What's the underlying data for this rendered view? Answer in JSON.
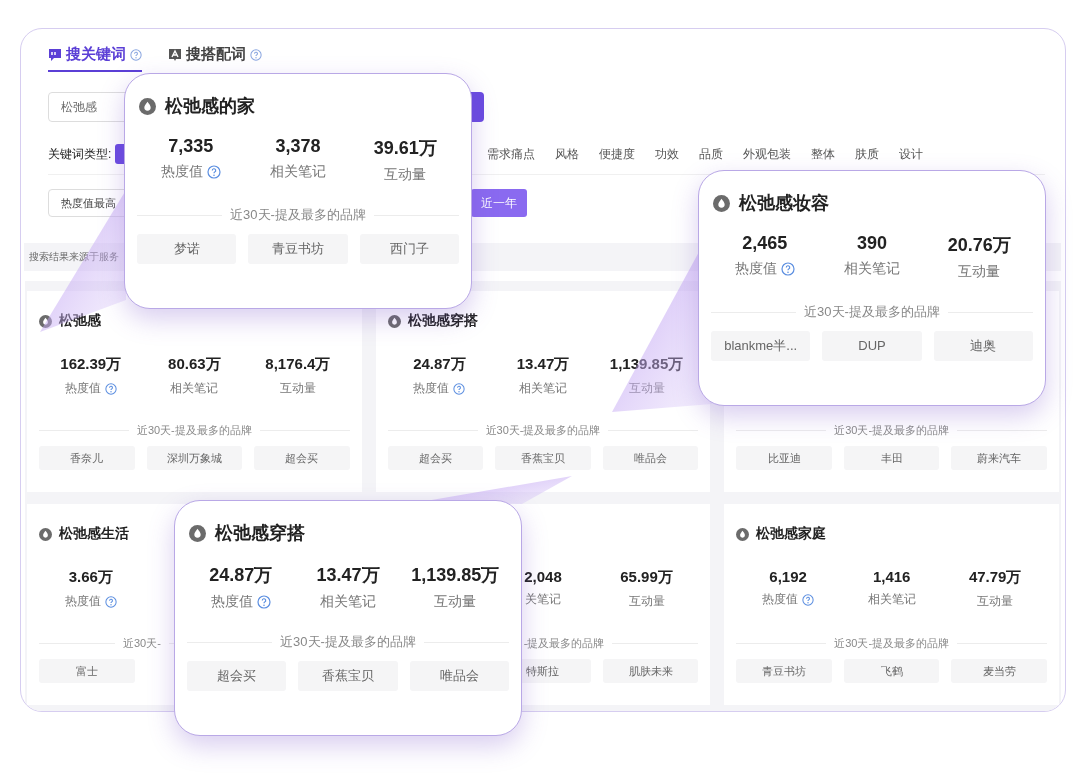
{
  "tabs": [
    {
      "label": "搜关键词",
      "selected": true
    },
    {
      "label": "搜搭配词",
      "selected": false
    }
  ],
  "search": {
    "value": "松弛感"
  },
  "keyword_filter": {
    "label": "关键词类型:",
    "options": [
      {
        "selected": true
      },
      {
        "label": "需求痛点",
        "selected": false
      },
      {
        "label": "风格",
        "selected": false
      },
      {
        "label": "便捷度",
        "selected": false
      },
      {
        "label": "功效",
        "selected": false
      },
      {
        "label": "品质",
        "selected": false
      },
      {
        "label": "外观包装",
        "selected": false
      },
      {
        "label": "整体",
        "selected": false
      },
      {
        "label": "肤质",
        "selected": false
      },
      {
        "label": "设计",
        "selected": false
      }
    ]
  },
  "sort": {
    "value": "热度值最高"
  },
  "period": {
    "label": "近一年",
    "selected": true
  },
  "notice": "搜索结果来源于服务",
  "cards": [
    {
      "title": "松弛感",
      "stats": [
        {
          "value": "162.39万",
          "label": "热度值",
          "help": true
        },
        {
          "value": "80.63万",
          "label": "相关笔记",
          "help": false
        },
        {
          "value": "8,176.4万",
          "label": "互动量",
          "help": false
        }
      ],
      "brands_heading": "近30天-提及最多的品牌",
      "brands": [
        "香奈儿",
        "深圳万象城",
        "超会买"
      ]
    },
    {
      "title": "松弛感穿搭",
      "stats": [
        {
          "value": "24.87万",
          "label": "热度值",
          "help": true
        },
        {
          "value": "13.47万",
          "label": "相关笔记",
          "help": false
        },
        {
          "value": "1,139.85万",
          "label": "互动量",
          "help": false
        }
      ],
      "brands_heading": "近30天-提及最多的品牌",
      "brands": [
        "超会买",
        "香蕉宝贝",
        "唯品会"
      ]
    },
    {
      "brands_heading": "近30天-提及最多的品牌",
      "brands": [
        "比亚迪",
        "丰田",
        "蔚来汽车"
      ]
    },
    {
      "title": "松弛感生活",
      "stats": [
        {
          "value": "3.66万",
          "label": "热度值",
          "help": true
        }
      ],
      "brands_heading": "近30天-",
      "brands": [
        "富士"
      ]
    },
    {
      "stats": [
        {
          "value": "2,048",
          "label": "关笔记",
          "help": false
        },
        {
          "value": "65.99万",
          "label": "互动量",
          "help": false
        }
      ],
      "brands_heading": "-提及最多的品牌",
      "brands": [
        "特斯拉",
        "肌肤未来"
      ]
    },
    {
      "title": "松弛感家庭",
      "stats": [
        {
          "value": "6,192",
          "label": "热度值",
          "help": true
        },
        {
          "value": "1,416",
          "label": "相关笔记",
          "help": false
        },
        {
          "value": "47.79万",
          "label": "互动量",
          "help": false
        }
      ],
      "brands_heading": "近30天-提及最多的品牌",
      "brands": [
        "青豆书坊",
        "飞鹤",
        "麦当劳"
      ]
    }
  ],
  "callouts": [
    {
      "title": "松弛感的家",
      "stats": [
        {
          "value": "7,335",
          "label": "热度值",
          "help": true
        },
        {
          "value": "3,378",
          "label": "相关笔记",
          "help": false
        },
        {
          "value": "39.61万",
          "label": "互动量",
          "help": false
        }
      ],
      "brands_heading": "近30天-提及最多的品牌",
      "brands": [
        "梦诺",
        "青豆书坊",
        "西门子"
      ]
    },
    {
      "title": "松弛感妆容",
      "stats": [
        {
          "value": "2,465",
          "label": "热度值",
          "help": true
        },
        {
          "value": "390",
          "label": "相关笔记",
          "help": false
        },
        {
          "value": "20.76万",
          "label": "互动量",
          "help": false
        }
      ],
      "brands_heading": "近30天-提及最多的品牌",
      "brands": [
        "blankme半...",
        "DUP",
        "迪奥"
      ]
    },
    {
      "title": "松弛感穿搭",
      "stats": [
        {
          "value": "24.87万",
          "label": "热度值",
          "help": true
        },
        {
          "value": "13.47万",
          "label": "相关笔记",
          "help": false
        },
        {
          "value": "1,139.85万",
          "label": "互动量",
          "help": false
        }
      ],
      "brands_heading": "近30天-提及最多的品牌",
      "brands": [
        "超会买",
        "香蕉宝贝",
        "唯品会"
      ]
    }
  ]
}
